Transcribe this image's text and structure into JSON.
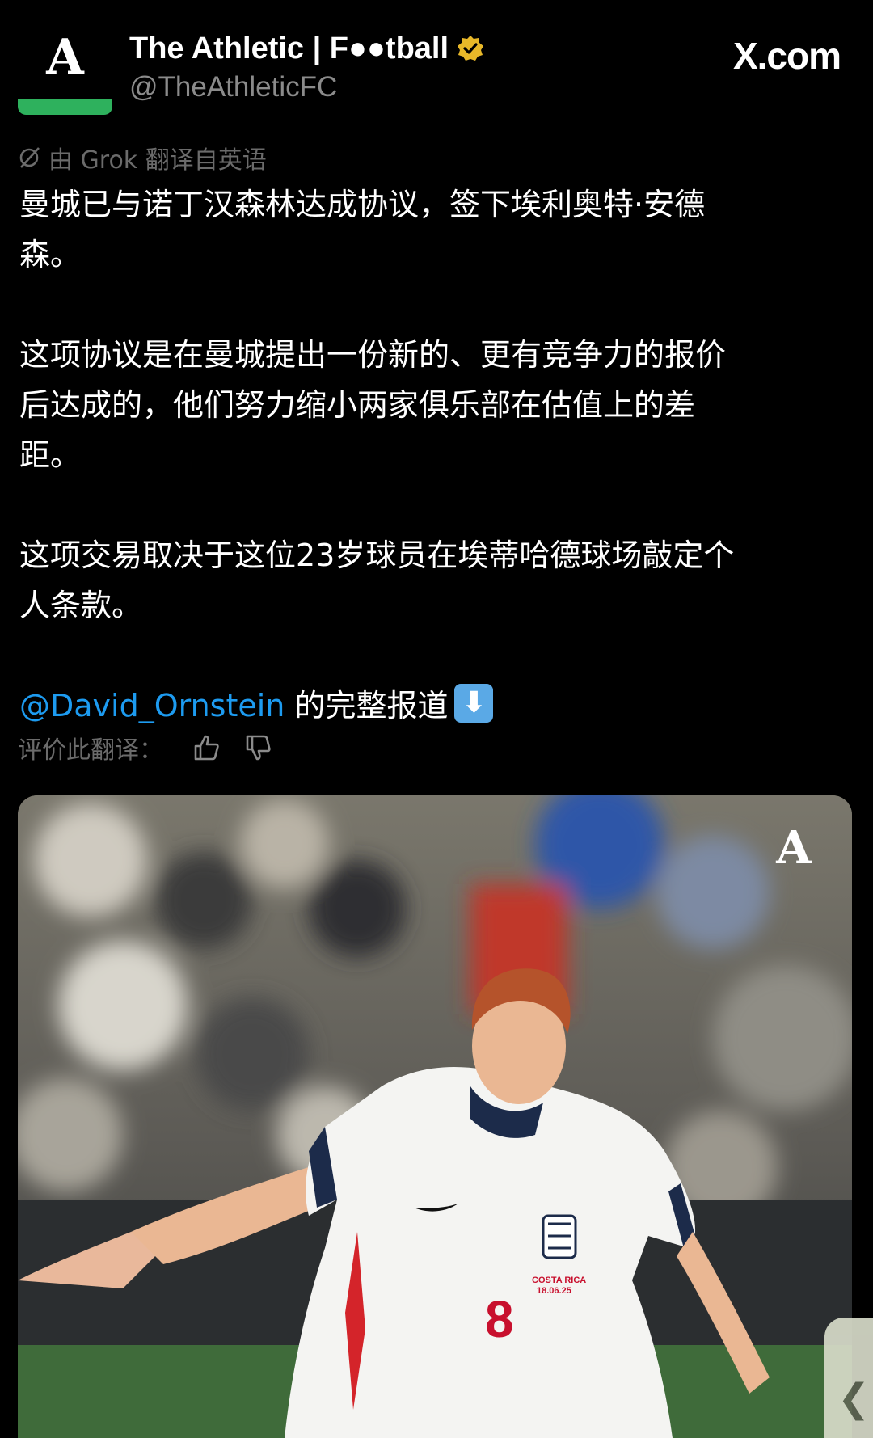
{
  "header": {
    "account_name": "The Athletic | F●●tball",
    "handle": "@TheAthleticFC",
    "site": "X.com",
    "avatar_letter": "A",
    "verified_color": "#e8b829",
    "brand_green": "#2eb15d"
  },
  "translation": {
    "label": "由 Grok 翻译自英语",
    "rate_label": "评价此翻译："
  },
  "tweet": {
    "para1_line1": "曼城已与诺丁汉森林达成协议，签下埃利奥特·安德",
    "para1_line2": "森。",
    "para2_line1": "这项协议是在曼城提出一份新的、更有竞争力的报价",
    "para2_line2": "后达成的，他们努力缩小两家俱乐部在估值上的差",
    "para2_line3": "距。",
    "para3_line1": "这项交易取决于这位23岁球员在埃蒂哈德球场敲定个",
    "para3_line2": "人条款。",
    "mention": "@David_Ornstein",
    "mention_suffix": " 的完整报道",
    "emoji": "⬇"
  },
  "media": {
    "watermark": "A",
    "shirt_number": "8",
    "shirt_text_1": "COSTA RICA",
    "shirt_text_2": "18.06.25"
  },
  "side_handle_glyph": "❮",
  "mention_color": "#1d9bf0"
}
